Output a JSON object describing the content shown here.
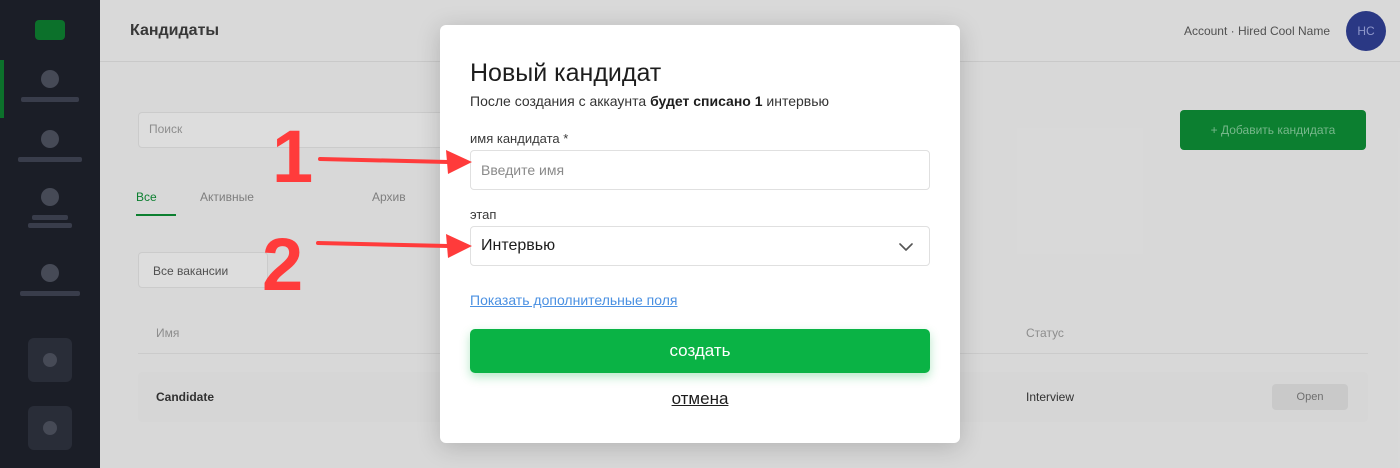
{
  "app": {
    "page_title": "Кандидаты",
    "user_text": "Account · Hired Cool Name",
    "avatar_initials": "HC",
    "colors": {
      "sidebar": "#1a1d27",
      "accent": "#0ab345",
      "link": "#4a90e2",
      "annotation": "#ff3b3b"
    }
  },
  "sidebar": {
    "items": [
      {
        "icon": "people-icon"
      },
      {
        "icon": "briefcase-icon"
      },
      {
        "icon": "chart-icon"
      },
      {
        "icon": "document-icon"
      }
    ]
  },
  "background": {
    "search_placeholder": "Поиск",
    "add_button": "+ Добавить кандидата",
    "tabs": [
      "Все",
      "Активные",
      "Архив"
    ],
    "filter_label": "Все вакансии",
    "table_headers": [
      "Имя",
      "Статус"
    ],
    "row": {
      "name": "Candidate",
      "status": "Interview",
      "badge": "Open"
    }
  },
  "modal": {
    "title": "Новый кандидат",
    "subtitle_prefix": "После создания с аккаунта ",
    "subtitle_bold": "будет списано 1",
    "subtitle_suffix": " интервью",
    "name_label": "имя кандидата *",
    "name_placeholder": "Введите имя",
    "name_value": "",
    "stage_label": "этап",
    "stage_value": "Интервью",
    "more_fields_link": "Показать дополнительные поля",
    "create_button": "создать",
    "cancel_link": "отмена"
  },
  "annotations": [
    {
      "label": "1"
    },
    {
      "label": "2"
    }
  ]
}
